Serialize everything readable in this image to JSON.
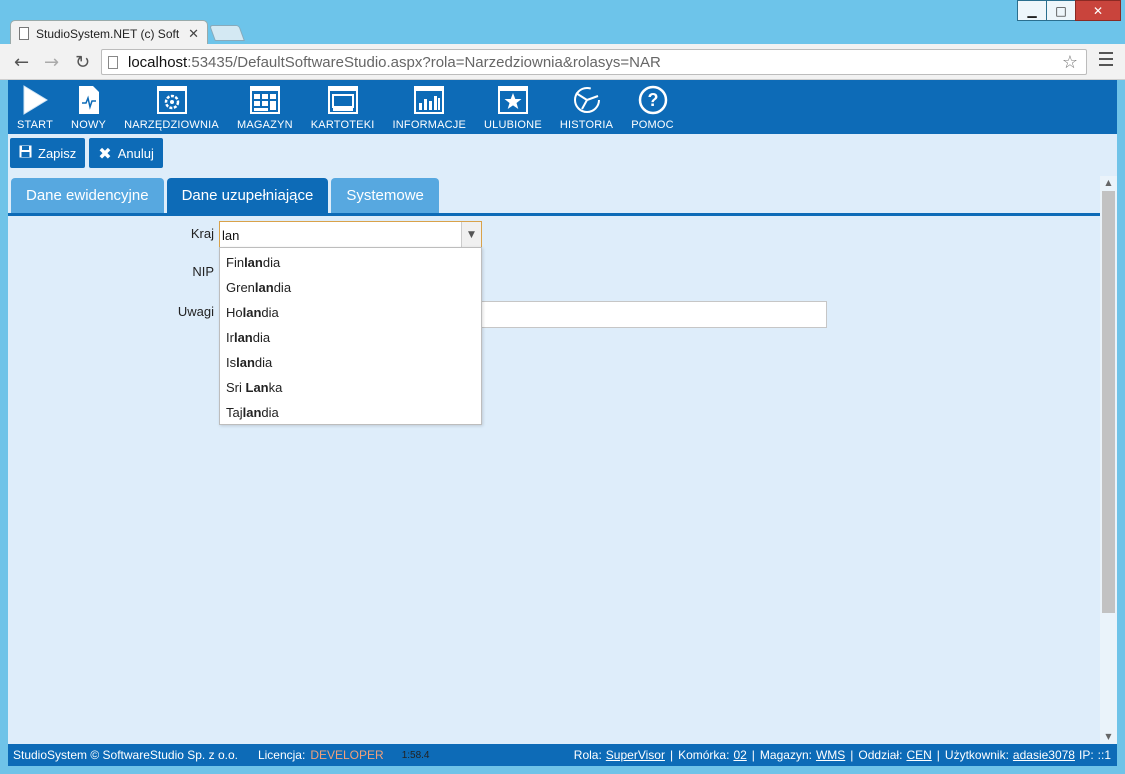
{
  "browser": {
    "tab_title": "StudioSystem.NET (c) Soft",
    "url_host": "localhost",
    "url_rest": ":53435/DefaultSoftwareStudio.aspx?rola=Narzedziownia&rolasys=NAR"
  },
  "toolbar": {
    "start": "START",
    "nowy": "NOWY",
    "narzedziownia": "NARZĘDZIOWNIA",
    "magazyn": "MAGAZYN",
    "kartoteki": "KARTOTEKI",
    "informacje": "INFORMACJE",
    "ulubione": "ULUBIONE",
    "historia": "HISTORIA",
    "pomoc": "POMOC"
  },
  "actions": {
    "zapisz": "Zapisz",
    "anuluj": "Anuluj"
  },
  "tabs": [
    "Dane ewidencyjne",
    "Dane uzupełniające",
    "Systemowe"
  ],
  "form": {
    "kraj_label": "Kraj",
    "kraj_value": "lan",
    "nip_label": "NIP",
    "uwagi_label": "Uwagi"
  },
  "dropdown": [
    {
      "pre": "Fin",
      "match": "lan",
      "post": "dia"
    },
    {
      "pre": "Gren",
      "match": "lan",
      "post": "dia"
    },
    {
      "pre": "Ho",
      "match": "lan",
      "post": "dia"
    },
    {
      "pre": "Ir",
      "match": "lan",
      "post": "dia"
    },
    {
      "pre": "Is",
      "match": "lan",
      "post": "dia"
    },
    {
      "pre": "Sri ",
      "match": "Lan",
      "post": "ka"
    },
    {
      "pre": "Taj",
      "match": "lan",
      "post": "dia"
    }
  ],
  "status": {
    "company": "StudioSystem © SoftwareStudio Sp. z o.o.",
    "licencja_label": "Licencja:",
    "licencja_value": "DEVELOPER",
    "time": "1:58.4",
    "rola_label": "Rola:",
    "rola_value": "SuperVisor",
    "komorka_label": "Komórka:",
    "komorka_value": "02",
    "magazyn_label": "Magazyn:",
    "magazyn_value": "WMS",
    "oddzial_label": "Oddział:",
    "oddzial_value": "CEN",
    "uzytkownik_label": "Użytkownik:",
    "uzytkownik_value": "adasie3078",
    "ip_label": "IP:",
    "ip_value": "::1"
  },
  "colors": {
    "brand_blue": "#0d6bb7",
    "tab_inactive": "#57a8e0",
    "page_bg": "#deedfa",
    "license_accent": "#f2a07a"
  }
}
